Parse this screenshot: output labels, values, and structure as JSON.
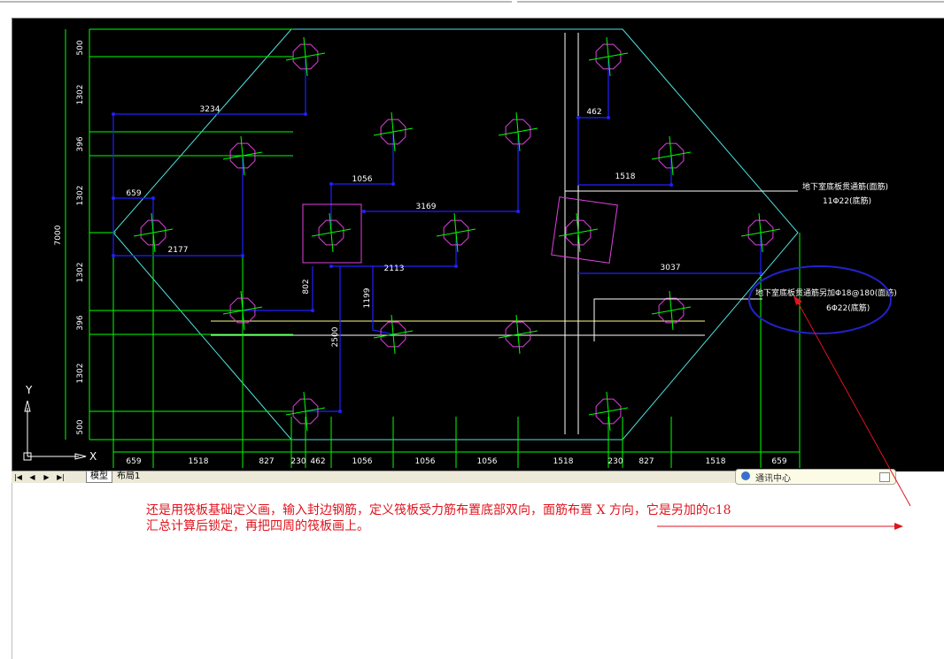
{
  "drawing": {
    "dims_bottom": [
      "659",
      "1518",
      "827",
      "230",
      "462",
      "1056",
      "1056",
      "1056",
      "1518",
      "230",
      "827",
      "1518",
      "659"
    ],
    "dims_left": [
      "500",
      "1302",
      "396",
      "1302",
      "1302",
      "396",
      "1302",
      "500"
    ],
    "dim_total": "7000",
    "inner_dims": [
      "3234",
      "659",
      "2177",
      "1056",
      "3169",
      "2113",
      "802",
      "1199",
      "2500",
      "462",
      "1518",
      "3037"
    ],
    "annotation_top": {
      "line1": "地下室底板贯通筋(面筋)",
      "line2": "11Φ22(底筋)"
    },
    "annotation_circled": {
      "line1": "地下室底板贯通筋另加Φ18@180(面筋)",
      "line2": "6Φ22(底筋)"
    },
    "axis_y": "Y",
    "axis_x": "X"
  },
  "tabs": {
    "nav": [
      "|◀",
      "◀",
      "▶",
      "▶|"
    ],
    "model": "模型",
    "layout": "布局1"
  },
  "popup": {
    "text": "通讯中心"
  },
  "note": {
    "line1": "还是用筏板基础定义画，输入封边钢筋，定义筏板受力筋布置底部双向，面筋布置 X 方向，它是另加的c18",
    "line2": "汇总计算后锁定，再把四周的筏板画上。"
  },
  "colors": {
    "background": "#000000",
    "green": "#00ff00",
    "cyan": "#4fe0e0",
    "blue": "#2020ff",
    "magenta": "#e040e0",
    "white": "#ffffff",
    "yellow": "#ffff80",
    "note_red": "#e0141d",
    "circle_blue": "#2222cc"
  }
}
